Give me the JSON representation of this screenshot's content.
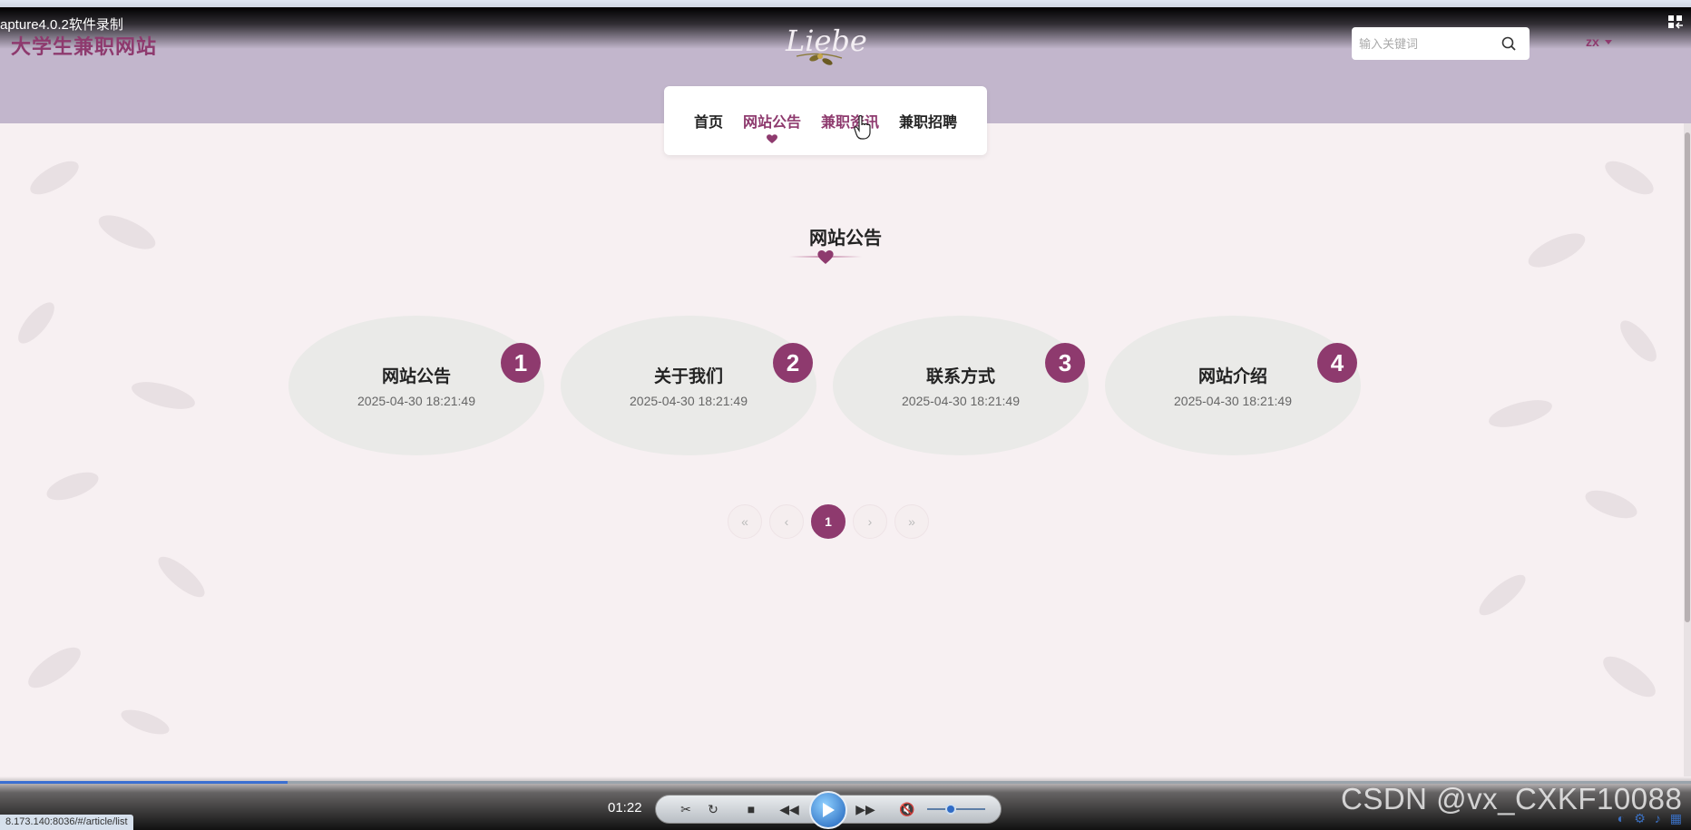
{
  "video": {
    "title": "apture4.0.2软件录制",
    "time": "01:22",
    "progress_fraction": 0.17,
    "volume_fraction": 0.4,
    "watermark": "CSDN @vx_CXKF10088",
    "status_url": "8.173.140:8036/#/article/list"
  },
  "header": {
    "site_title": "大学生兼职网站",
    "logo_text": "Liebe",
    "search_placeholder": "输入关键词",
    "user_name": "zx"
  },
  "nav": {
    "items": [
      {
        "label": "首页"
      },
      {
        "label": "网站公告"
      },
      {
        "label": "兼职资讯"
      },
      {
        "label": "兼职招聘"
      }
    ],
    "active_index": 1
  },
  "section": {
    "title": "网站公告"
  },
  "cards": [
    {
      "title": "网站公告",
      "date": "2025-04-30 18:21:49",
      "badge": "1"
    },
    {
      "title": "关于我们",
      "date": "2025-04-30 18:21:49",
      "badge": "2"
    },
    {
      "title": "联系方式",
      "date": "2025-04-30 18:21:49",
      "badge": "3"
    },
    {
      "title": "网站介绍",
      "date": "2025-04-30 18:21:49",
      "badge": "4"
    }
  ],
  "pagination": {
    "first": "«",
    "prev": "‹",
    "current": "1",
    "next": "›",
    "last": "»"
  },
  "colors": {
    "brand": "#8e3a6e",
    "header_bg": "#c2b6cc",
    "page_bg": "#f7f0f2",
    "card_bg": "#eaeae8"
  }
}
